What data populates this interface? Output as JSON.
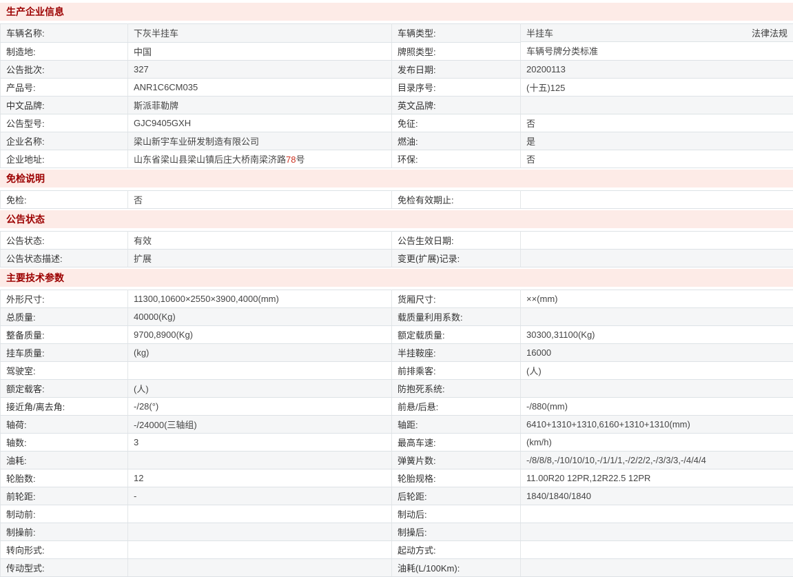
{
  "colors": {
    "section_header_background": "#fdebe7",
    "section_header_text": "#9c0000",
    "row_stripe": "#f5f6f7",
    "address_highlight": "#cc3322"
  },
  "link": {
    "laws_label": "法律法规"
  },
  "sections": [
    {
      "title": "生产企业信息",
      "rows": [
        [
          "车辆名称:",
          "下灰半挂车",
          "车辆类型:",
          {
            "text": "半挂车",
            "link": "法律法规"
          }
        ],
        [
          "制造地:",
          "中国",
          "牌照类型:",
          "车辆号牌分类标准"
        ],
        [
          "公告批次:",
          "327",
          "发布日期:",
          "20200113"
        ],
        [
          "产品号:",
          "ANR1C6CM035",
          "目录序号:",
          "(十五)125"
        ],
        [
          "中文品牌:",
          "斯派菲勒牌",
          "英文品牌:",
          ""
        ],
        [
          "公告型号:",
          "GJC9405GXH",
          "免征:",
          "否"
        ],
        [
          "企业名称:",
          "梁山新宇车业研发制造有限公司",
          "燃油:",
          "是"
        ],
        [
          "企业地址:",
          {
            "parts": [
              "山东省梁山县梁山镇后庄大桥南梁济路",
              {
                "hl": "78"
              },
              "号"
            ]
          },
          "环保:",
          "否"
        ]
      ]
    },
    {
      "title": "免检说明",
      "rows": [
        [
          "免检:",
          "否",
          "免检有效期止:",
          ""
        ]
      ]
    },
    {
      "title": "公告状态",
      "rows": [
        [
          "公告状态:",
          "有效",
          "公告生效日期:",
          ""
        ],
        [
          "公告状态描述:",
          "扩展",
          "变更(扩展)记录:",
          ""
        ]
      ]
    },
    {
      "title": "主要技术参数",
      "rows": [
        [
          "外形尺寸:",
          "11300,10600×2550×3900,4000(mm)",
          "货厢尺寸:",
          "××(mm)"
        ],
        [
          "总质量:",
          "40000(Kg)",
          "载质量利用系数:",
          ""
        ],
        [
          "整备质量:",
          "9700,8900(Kg)",
          "额定载质量:",
          "30300,31100(Kg)"
        ],
        [
          "挂车质量:",
          "(kg)",
          "半挂鞍座:",
          "16000"
        ],
        [
          "驾驶室:",
          "",
          "前排乘客:",
          "(人)"
        ],
        [
          "额定载客:",
          "(人)",
          "防抱死系统:",
          ""
        ],
        [
          "接近角/离去角:",
          "-/28(°)",
          "前悬/后悬:",
          "-/880(mm)"
        ],
        [
          "轴荷:",
          "-/24000(三轴组)",
          "轴距:",
          "6410+1310+1310,6160+1310+1310(mm)"
        ],
        [
          "轴数:",
          "3",
          "最高车速:",
          "(km/h)"
        ],
        [
          "油耗:",
          "",
          "弹簧片数:",
          "-/8/8/8,-/10/10/10,-/1/1/1,-/2/2/2,-/3/3/3,-/4/4/4"
        ],
        [
          "轮胎数:",
          "12",
          "轮胎规格:",
          "11.00R20 12PR,12R22.5 12PR"
        ],
        [
          "前轮距:",
          "-",
          "后轮距:",
          "1840/1840/1840"
        ],
        [
          "制动前:",
          "",
          "制动后:",
          ""
        ],
        [
          "制操前:",
          "",
          "制操后:",
          ""
        ],
        [
          "转向形式:",
          "",
          "起动方式:",
          ""
        ],
        [
          "传动型式:",
          "",
          "油耗(L/100Km):",
          ""
        ]
      ]
    }
  ]
}
